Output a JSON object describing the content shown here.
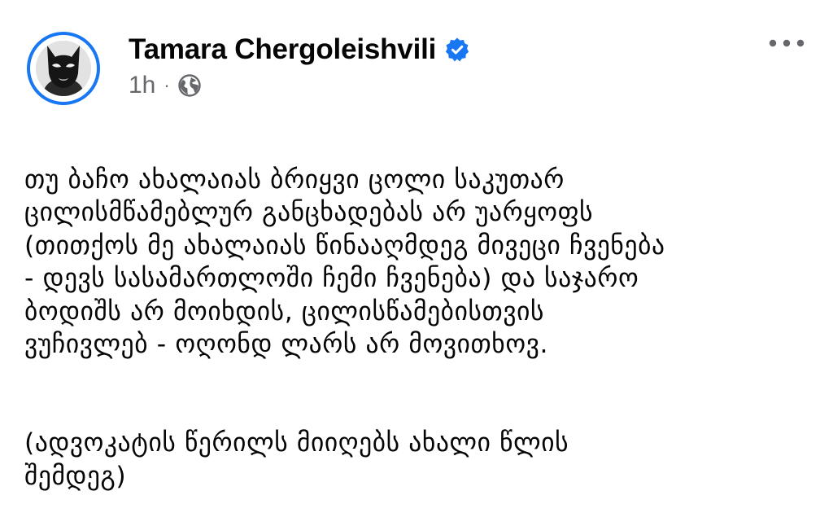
{
  "post": {
    "author": {
      "name": "Tamara Chergoleishvili",
      "verified": true
    },
    "time": "1h",
    "separator": "·",
    "audience_icon": "globe-icon",
    "more_icon": "more-horizontal-icon",
    "paragraphs": [
      "თუ ბაჩო ახალაიას ბრიყვი ცოლი საკუთარ\nცილისმწამებლურ განცხადებას არ უარყოფს\n(თითქოს მე ახალაიას წინააღმდეგ მივეცი ჩვენება\n- დევს სასამართლოში ჩემი ჩვენება) და საჯარო\nბოდიშს არ მოიხდის, ცილისწამებისთვის\nვუჩივლებ - ოღონდ ლარს არ მოვითხოვ.",
      "(ადვოკატის წერილს მიიღებს ახალი წლის\nშემდეგ)"
    ]
  },
  "colors": {
    "text": "#050505",
    "secondary": "#65676b",
    "accent": "#1877f2"
  }
}
